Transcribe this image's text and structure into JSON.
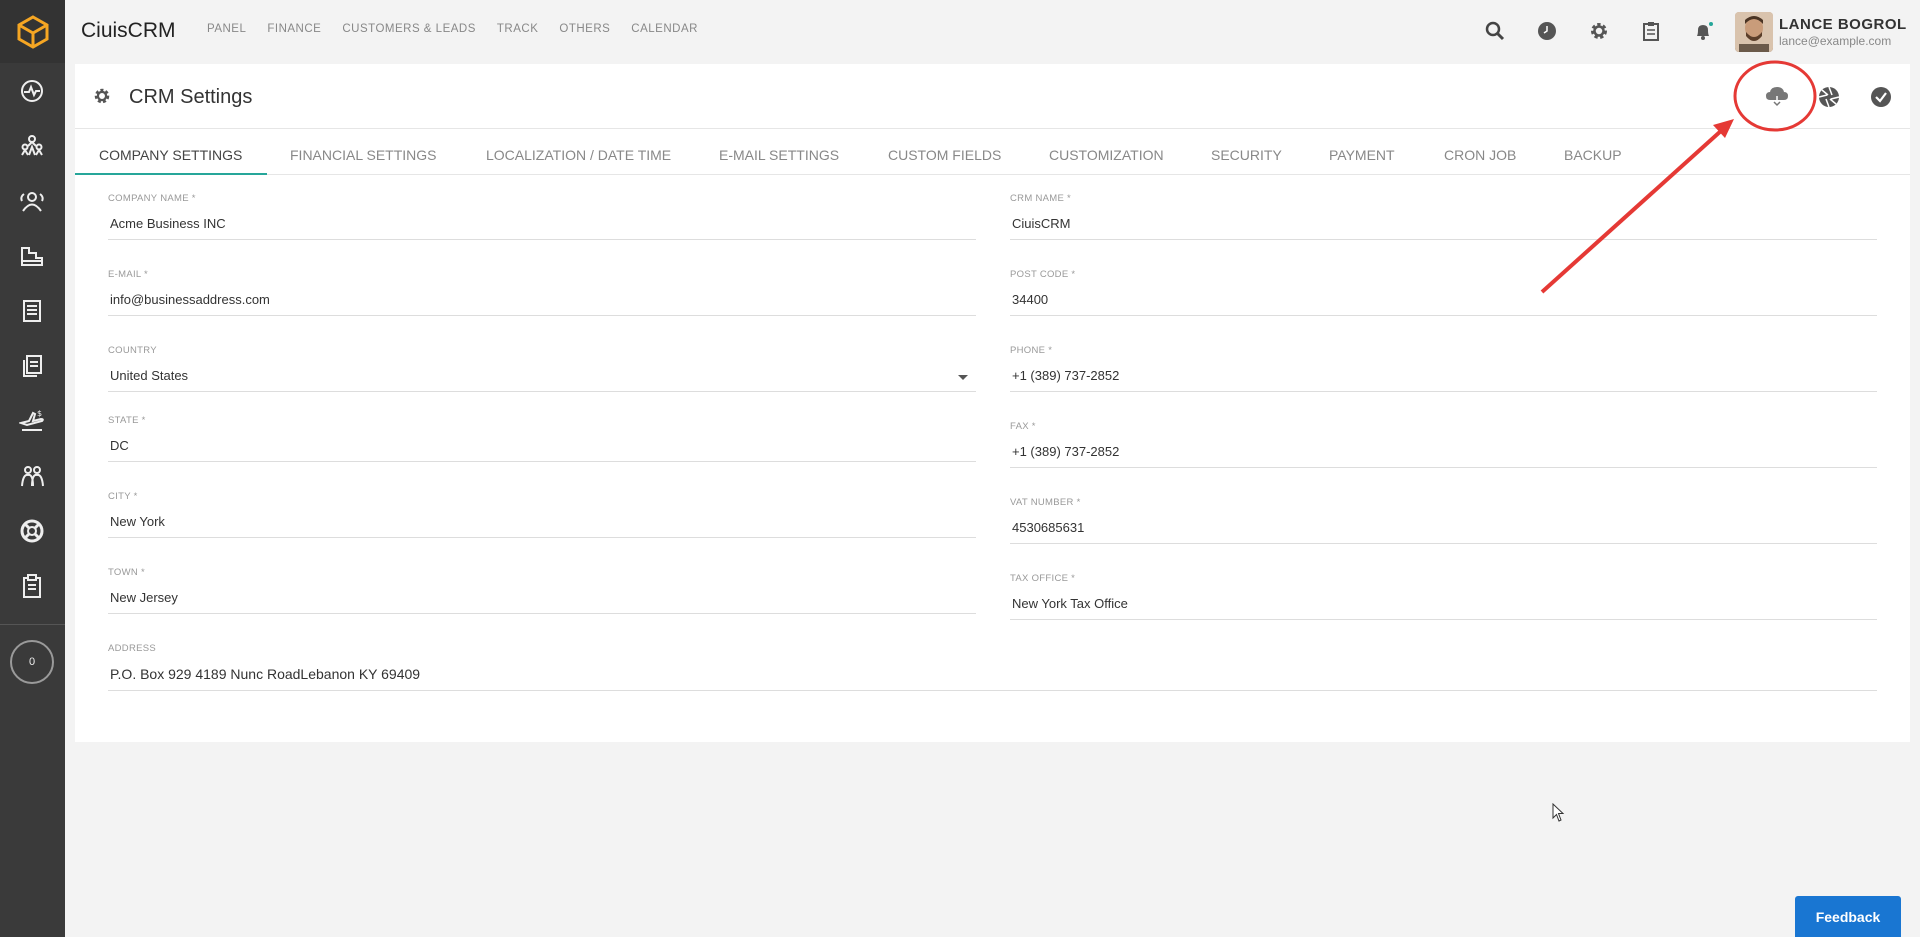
{
  "app": {
    "brand": "CiuisCRM"
  },
  "topnav": [
    "PANEL",
    "FINANCE",
    "CUSTOMERS & LEADS",
    "TRACK",
    "OTHERS",
    "CALENDAR"
  ],
  "user": {
    "name": "LANCE BOGROL",
    "email": "lance@example.com"
  },
  "sidebar": {
    "counter": "0"
  },
  "page": {
    "title": "CRM Settings"
  },
  "tabs": [
    "COMPANY SETTINGS",
    "FINANCIAL SETTINGS",
    "LOCALIZATION / DATE TIME",
    "E-MAIL SETTINGS",
    "CUSTOM FIELDS",
    "CUSTOMIZATION",
    "SECURITY",
    "PAYMENT",
    "CRON JOB",
    "BACKUP"
  ],
  "form": {
    "company_name": {
      "label": "COMPANY NAME *",
      "value": "Acme Business INC"
    },
    "crm_name": {
      "label": "CRM NAME *",
      "value": "CiuisCRM"
    },
    "email": {
      "label": "E-MAIL *",
      "value": "info@businessaddress.com"
    },
    "post_code": {
      "label": "POST CODE *",
      "value": "34400"
    },
    "country": {
      "label": "COUNTRY",
      "value": "United States"
    },
    "phone": {
      "label": "PHONE *",
      "value": "+1 (389) 737-2852"
    },
    "state": {
      "label": "STATE *",
      "value": "DC"
    },
    "fax": {
      "label": "FAX *",
      "value": "+1 (389) 737-2852"
    },
    "city": {
      "label": "CITY *",
      "value": "New York"
    },
    "vat_number": {
      "label": "VAT NUMBER *",
      "value": "4530685631"
    },
    "town": {
      "label": "TOWN *",
      "value": "New Jersey"
    },
    "tax_office": {
      "label": "TAX OFFICE *",
      "value": "New York Tax Office"
    },
    "address": {
      "label": "ADDRESS",
      "value": "P.O. Box 929 4189 Nunc RoadLebanon KY 69409"
    }
  },
  "feedback": "Feedback",
  "icons": {
    "sidebar": [
      "activity-icon",
      "leads-icon",
      "customers-icon",
      "projects-icon",
      "invoices-icon",
      "documents-icon",
      "expenses-icon",
      "staff-icon",
      "support-icon",
      "tasks-icon"
    ],
    "actions": [
      "cloud-download-icon",
      "aperture-icon",
      "check-circle-icon"
    ]
  },
  "colors": {
    "accent": "#26a69a",
    "logo": "#f5a623",
    "annotation": "#e53935",
    "feedback": "#1976d2"
  }
}
